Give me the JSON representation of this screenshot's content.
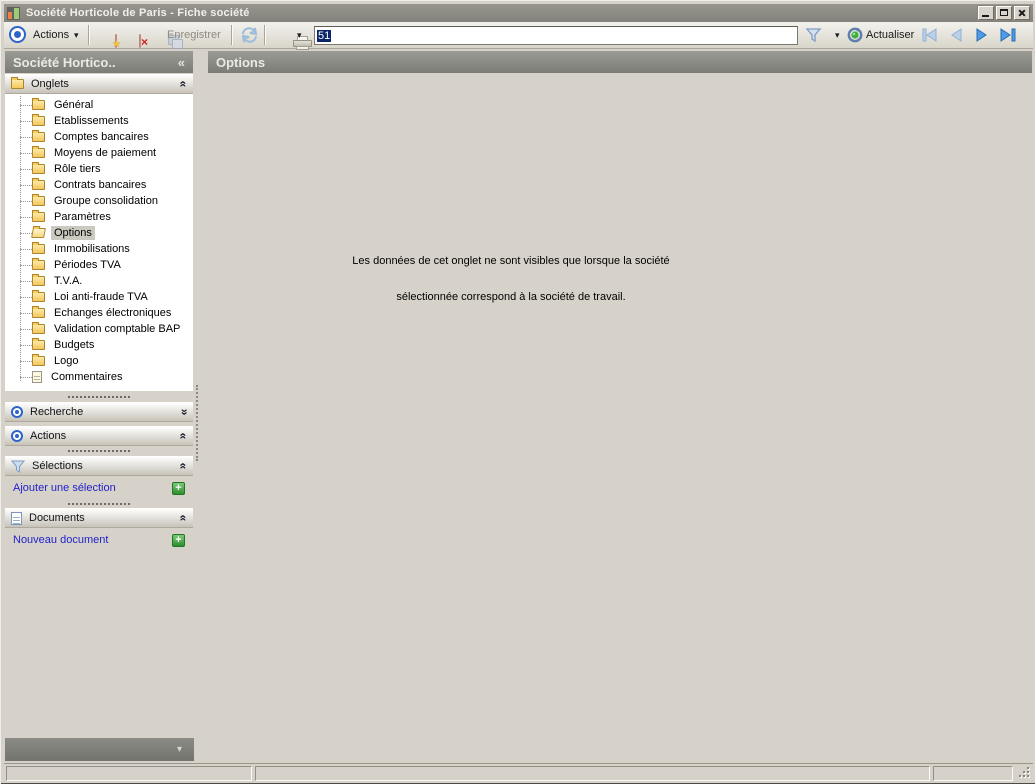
{
  "window": {
    "title": "Société Horticole de Paris -  Fiche société"
  },
  "toolbar": {
    "actions_label": "Actions",
    "enregistrer_label": "Enregistrer",
    "record_value": "51",
    "actualiser_label": "Actualiser"
  },
  "icons": {
    "caret": "▾",
    "collapse": "«",
    "chevron": "«",
    "star": "★",
    "cross": "×",
    "plus": "+"
  },
  "sidebar": {
    "header_title": "Société Hortico..",
    "onglets_label": "Onglets",
    "tree": [
      {
        "label": "Général"
      },
      {
        "label": "Etablissements"
      },
      {
        "label": "Comptes bancaires"
      },
      {
        "label": "Moyens de paiement"
      },
      {
        "label": "Rôle tiers"
      },
      {
        "label": "Contrats bancaires"
      },
      {
        "label": "Groupe consolidation"
      },
      {
        "label": "Paramètres"
      },
      {
        "label": "Options",
        "selected": true
      },
      {
        "label": "Immobilisations"
      },
      {
        "label": "Périodes TVA"
      },
      {
        "label": "T.V.A."
      },
      {
        "label": "Loi anti-fraude TVA"
      },
      {
        "label": "Echanges électroniques"
      },
      {
        "label": "Validation comptable BAP"
      },
      {
        "label": "Budgets"
      },
      {
        "label": "Logo"
      },
      {
        "label": "Commentaires",
        "icon": "note"
      }
    ],
    "sections": {
      "recherche": {
        "label": "Recherche"
      },
      "actions": {
        "label": "Actions"
      },
      "selections": {
        "label": "Sélections",
        "link": "Ajouter une sélection"
      },
      "documents": {
        "label": "Documents",
        "link": "Nouveau document"
      }
    }
  },
  "main": {
    "header_title": "Options",
    "message_line1": "Les données de cet onglet ne sont visibles que lorsque la société",
    "message_line2": "sélectionnée correspond à la société de travail."
  },
  "colors": {
    "accent_blue": "#2e64c8",
    "titlebar_gray": "#8a8a84",
    "selection_navy": "#0a246a",
    "link_blue": "#2222cc",
    "plus_green": "#2e8f2e",
    "window_beige": "#d6d2c9"
  }
}
